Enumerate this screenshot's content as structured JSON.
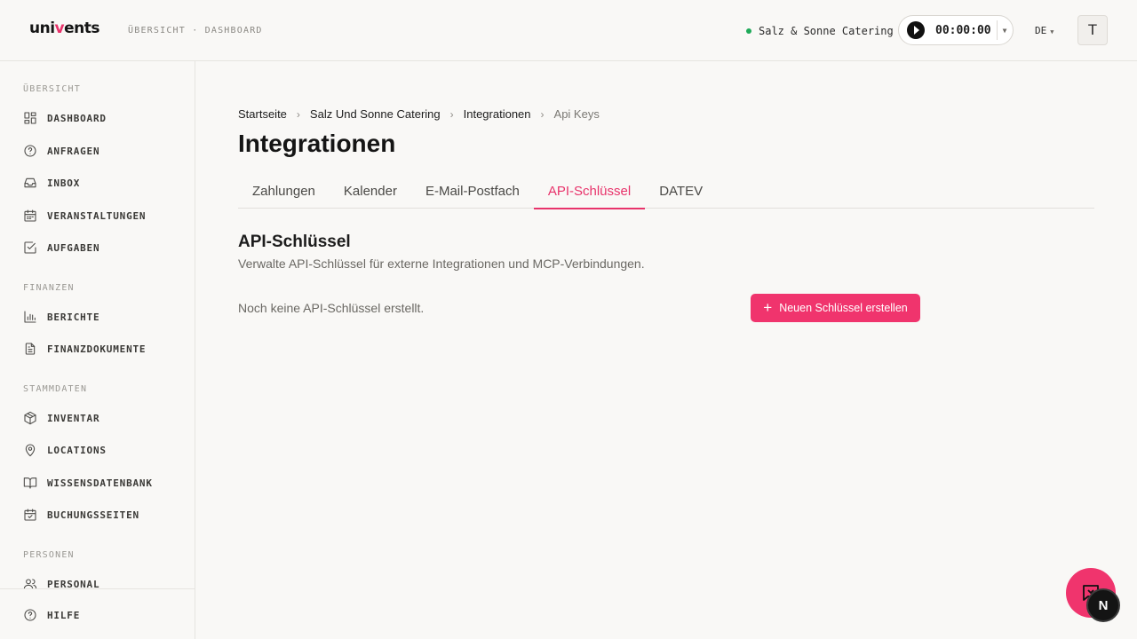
{
  "header": {
    "logo_pre": "uni",
    "logo_accent": "v",
    "logo_post": "ents",
    "breadcrumb": "ÜBERSICHT · DASHBOARD",
    "company": "Salz & Sonne Catering",
    "timer": "00:00:00",
    "language": "DE",
    "avatar_initial": "T"
  },
  "sidebar": {
    "sections": [
      {
        "label": "ÜBERSICHT",
        "items": [
          {
            "label": "DASHBOARD",
            "icon": "dashboard-icon"
          },
          {
            "label": "ANFRAGEN",
            "icon": "help-circle-icon"
          },
          {
            "label": "INBOX",
            "icon": "inbox-icon"
          },
          {
            "label": "VERANSTALTUNGEN",
            "icon": "calendar-icon"
          },
          {
            "label": "AUFGABEN",
            "icon": "check-square-icon"
          }
        ]
      },
      {
        "label": "FINANZEN",
        "items": [
          {
            "label": "BERICHTE",
            "icon": "bar-chart-icon"
          },
          {
            "label": "FINANZDOKUMENTE",
            "icon": "file-text-icon"
          }
        ]
      },
      {
        "label": "STAMMDATEN",
        "items": [
          {
            "label": "INVENTAR",
            "icon": "package-icon"
          },
          {
            "label": "LOCATIONS",
            "icon": "map-pin-icon"
          },
          {
            "label": "WISSENSDATENBANK",
            "icon": "book-icon"
          },
          {
            "label": "BUCHUNGSSEITEN",
            "icon": "calendar-check-icon"
          }
        ]
      },
      {
        "label": "PERSONEN",
        "items": [
          {
            "label": "PERSONAL",
            "icon": "users-icon"
          }
        ]
      }
    ],
    "footer": {
      "label": "HILFE",
      "icon": "help-circle-icon"
    }
  },
  "main": {
    "breadcrumb": [
      "Startseite",
      "Salz Und Sonne Catering",
      "Integrationen",
      "Api Keys"
    ],
    "title": "Integrationen",
    "tabs": [
      {
        "label": "Zahlungen",
        "active": false
      },
      {
        "label": "Kalender",
        "active": false
      },
      {
        "label": "E-Mail-Postfach",
        "active": false
      },
      {
        "label": "API-Schlüssel",
        "active": true
      },
      {
        "label": "DATEV",
        "active": false
      }
    ],
    "section_title": "API-Schlüssel",
    "section_desc": "Verwalte API-Schlüssel für externe Integrationen und MCP-Verbindungen.",
    "empty_text": "Noch keine API-Schlüssel erstellt.",
    "create_button": "Neuen Schlüssel erstellen"
  },
  "widgets": {
    "badge_letter": "N"
  },
  "colors": {
    "accent": "#f0346d",
    "status_green": "#1faa59"
  }
}
